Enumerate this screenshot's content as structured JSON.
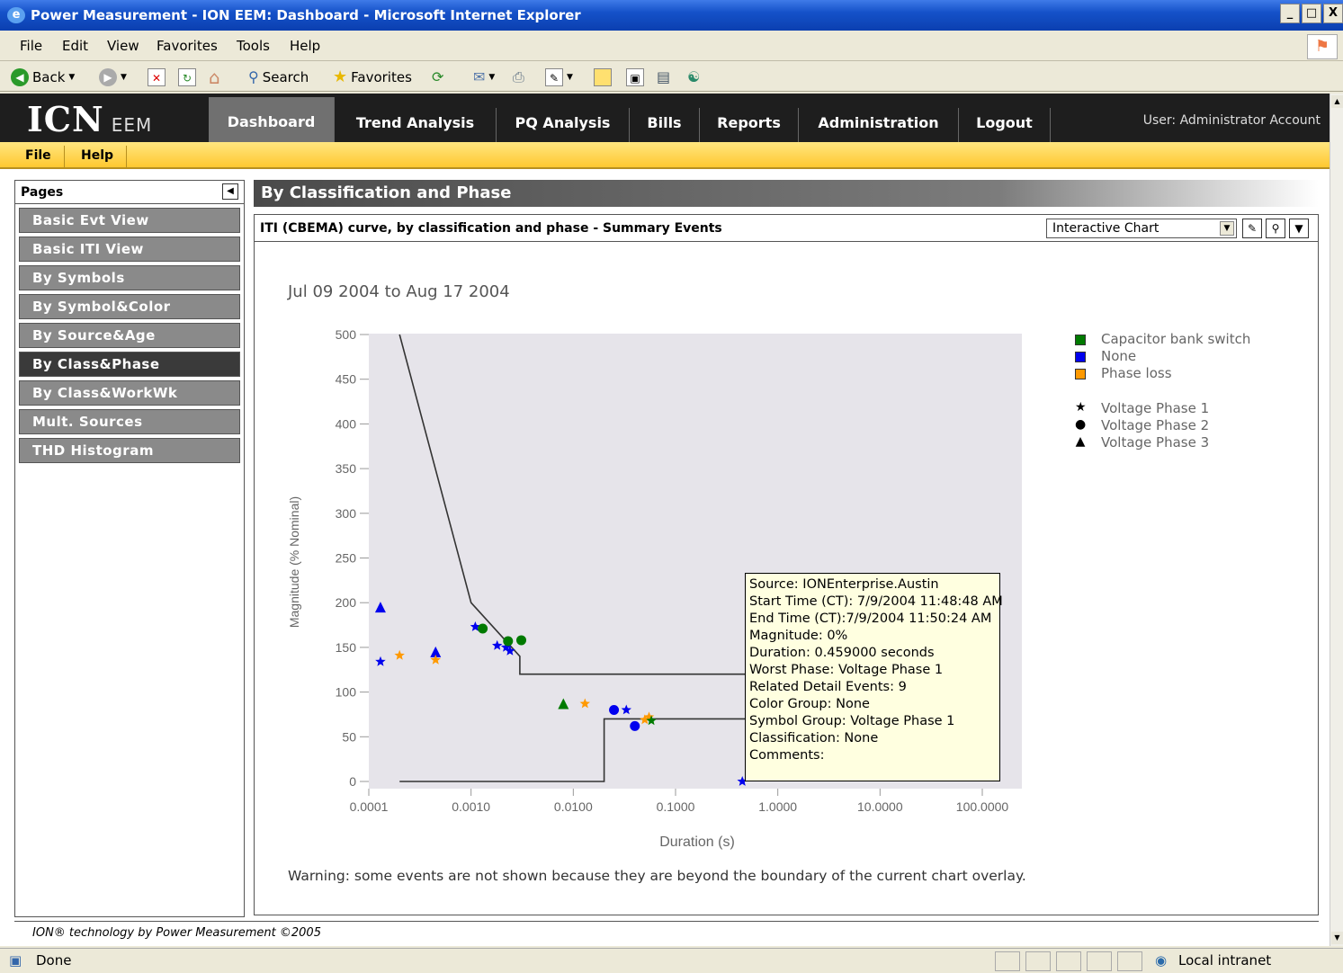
{
  "window": {
    "title": "Power Measurement - ION EEM: Dashboard - Microsoft Internet Explorer",
    "buttons": [
      "_",
      "□",
      "X"
    ]
  },
  "menubar": {
    "items": [
      "File",
      "Edit",
      "View",
      "Favorites",
      "Tools",
      "Help"
    ]
  },
  "toolbar": {
    "back": "Back",
    "search": "Search",
    "favorites": "Favorites"
  },
  "app": {
    "logo": "ICN",
    "logo_suffix": "EEM",
    "tabs": [
      "Dashboard",
      "Trend Analysis",
      "PQ Analysis",
      "Bills",
      "Reports",
      "Administration",
      "Logout"
    ],
    "active_tab": "Dashboard",
    "user": "User: Administrator Account",
    "submenu": [
      "File",
      "Help"
    ]
  },
  "pages": {
    "header": "Pages",
    "items": [
      "Basic Evt View",
      "Basic ITI View",
      "By Symbols",
      "By Symbol&Color",
      "By Source&Age",
      "By Class&Phase",
      "By Class&WorkWk",
      "Mult. Sources",
      "THD Histogram"
    ],
    "active": "By Class&Phase"
  },
  "main": {
    "heading": "By Classification and Phase",
    "chart_title": "ITI (CBEMA) curve, by classification and phase - Summary Events",
    "view_select": "Interactive Chart",
    "date_range": "Jul 09 2004 to Aug 17 2004",
    "warning": "Warning: some events are not shown because they are beyond the boundary of the current chart overlay."
  },
  "tooltip": {
    "lines": [
      "Source: IONEnterprise.Austin",
      "Start Time (CT): 7/9/2004 11:48:48 AM",
      "End Time (CT):7/9/2004 11:50:24 AM",
      "Magnitude: 0%",
      "Duration: 0.459000 seconds",
      "Worst Phase: Voltage Phase 1",
      "Related Detail Events: 9",
      "Color Group: None",
      "Symbol Group: Voltage Phase 1",
      "Classification: None",
      "Comments:"
    ]
  },
  "legend": {
    "colors": [
      {
        "label": "Capacitor bank switch",
        "color": "#007a00"
      },
      {
        "label": "None",
        "color": "#0000ee"
      },
      {
        "label": "Phase loss",
        "color": "#ff9900"
      }
    ],
    "symbols": [
      {
        "label": "Voltage Phase 1",
        "symbol": "★"
      },
      {
        "label": "Voltage Phase 2",
        "symbol": "●"
      },
      {
        "label": "Voltage Phase 3",
        "symbol": "▲"
      }
    ]
  },
  "chart_data": {
    "type": "scatter",
    "xlabel": "Duration (s)",
    "ylabel": "Magnitude (% Nominal)",
    "x_scale": "log",
    "xlim": [
      0.0001,
      100
    ],
    "ylim": [
      0,
      500
    ],
    "x_ticks": [
      "0.0001",
      "0.0010",
      "0.0100",
      "0.1000",
      "1.0000",
      "10.0000",
      "100.0000"
    ],
    "y_ticks": [
      "0",
      "50",
      "100",
      "150",
      "200",
      "250",
      "300",
      "350",
      "400",
      "450",
      "500"
    ],
    "background": "#e6e4ea",
    "iti_upper": [
      [
        0.0002,
        500
      ],
      [
        0.001,
        200
      ],
      [
        0.003,
        140
      ],
      [
        0.003,
        120
      ],
      [
        0.5,
        120
      ]
    ],
    "iti_lower": [
      [
        0.5,
        70
      ],
      [
        0.02,
        70
      ],
      [
        0.02,
        0
      ],
      [
        0.0002,
        0
      ]
    ],
    "points": [
      {
        "x": 0.00013,
        "y": 134,
        "class": "None",
        "phase": "Voltage Phase 1"
      },
      {
        "x": 0.00013,
        "y": 194,
        "class": "None",
        "phase": "Voltage Phase 3"
      },
      {
        "x": 0.0002,
        "y": 141,
        "class": "Phase loss",
        "phase": "Voltage Phase 1"
      },
      {
        "x": 0.00045,
        "y": 144,
        "class": "None",
        "phase": "Voltage Phase 3"
      },
      {
        "x": 0.00045,
        "y": 136,
        "class": "Phase loss",
        "phase": "Voltage Phase 1"
      },
      {
        "x": 0.0011,
        "y": 173,
        "class": "None",
        "phase": "Voltage Phase 1"
      },
      {
        "x": 0.0013,
        "y": 171,
        "class": "Capacitor bank switch",
        "phase": "Voltage Phase 2"
      },
      {
        "x": 0.0018,
        "y": 152,
        "class": "None",
        "phase": "Voltage Phase 1"
      },
      {
        "x": 0.0022,
        "y": 150,
        "class": "None",
        "phase": "Voltage Phase 1"
      },
      {
        "x": 0.0024,
        "y": 146,
        "class": "None",
        "phase": "Voltage Phase 1"
      },
      {
        "x": 0.0023,
        "y": 157,
        "class": "Capacitor bank switch",
        "phase": "Voltage Phase 2"
      },
      {
        "x": 0.0031,
        "y": 158,
        "class": "Capacitor bank switch",
        "phase": "Voltage Phase 2"
      },
      {
        "x": 0.008,
        "y": 86,
        "class": "Capacitor bank switch",
        "phase": "Voltage Phase 3"
      },
      {
        "x": 0.013,
        "y": 87,
        "class": "Phase loss",
        "phase": "Voltage Phase 1"
      },
      {
        "x": 0.025,
        "y": 80,
        "class": "None",
        "phase": "Voltage Phase 2"
      },
      {
        "x": 0.033,
        "y": 80,
        "class": "None",
        "phase": "Voltage Phase 1"
      },
      {
        "x": 0.04,
        "y": 62,
        "class": "None",
        "phase": "Voltage Phase 2"
      },
      {
        "x": 0.05,
        "y": 69,
        "class": "Phase loss",
        "phase": "Voltage Phase 1"
      },
      {
        "x": 0.055,
        "y": 72,
        "class": "Phase loss",
        "phase": "Voltage Phase 1"
      },
      {
        "x": 0.058,
        "y": 68,
        "class": "Capacitor bank switch",
        "phase": "Voltage Phase 1"
      },
      {
        "x": 0.45,
        "y": 0,
        "class": "None",
        "phase": "Voltage Phase 1"
      }
    ]
  },
  "footer": "ION® technology by Power Measurement ©2005",
  "status": {
    "left": "Done",
    "right": "Local intranet"
  }
}
